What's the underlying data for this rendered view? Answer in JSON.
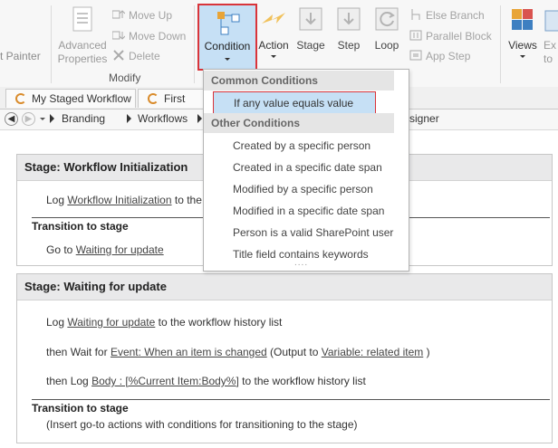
{
  "ribbon": {
    "format_painter": "t Painter",
    "advanced_properties": [
      "Advanced",
      "Properties"
    ],
    "move_up": "Move Up",
    "move_down": "Move Down",
    "delete": "Delete",
    "modify_group": "Modify",
    "condition": "Condition",
    "action": "Action",
    "stage": "Stage",
    "step": "Step",
    "loop": "Loop",
    "else_branch": "Else Branch",
    "parallel_block": "Parallel Block",
    "app_step": "App Step",
    "views": "Views",
    "export_partial": [
      "Ex",
      "to"
    ]
  },
  "tabs": [
    "My Staged Workflow",
    "First Stag"
  ],
  "breadcrumb": [
    "Branding",
    "Workflows",
    "signer"
  ],
  "dropdown": {
    "common_header": "Common Conditions",
    "common_items": [
      "If any value equals value"
    ],
    "other_header": "Other Conditions",
    "other_items": [
      "Created by a specific person",
      "Created in a specific date span",
      "Modified by a specific person",
      "Modified in a specific date span",
      "Person is a valid SharePoint user",
      "Title field contains keywords"
    ],
    "more": "...."
  },
  "stage1": {
    "title": "Stage: Workflow Initialization",
    "log_prefix": "Log",
    "log_link": "Workflow Initialization",
    "log_suffix": "to the",
    "transition_label": "Transition to stage",
    "goto_prefix": "Go to",
    "goto_link": "Waiting for update"
  },
  "stage2": {
    "title": "Stage: Waiting for update",
    "l1_prefix": "Log",
    "l1_link": "Waiting for update",
    "l1_suffix": "to the workflow history list",
    "l2_prefix": "then Wait for",
    "l2_link": "Event: When an item is changed",
    "l2_mid": "(Output to",
    "l2_link2": "Variable: related item",
    "l2_suffix": ")",
    "l3_prefix": "then Log",
    "l3_link": "Body : [%Current Item:Body%]",
    "l3_suffix": "to the workflow history list",
    "transition_label": "Transition to stage",
    "transition_hint": "(Insert go-to actions with conditions for transitioning to the stage)"
  },
  "colors": {
    "highlight_border": "#d9343a",
    "selected_fill": "#c6e0f5",
    "accent_orange": "#e8a437",
    "accent_blue": "#3d7fc1"
  }
}
